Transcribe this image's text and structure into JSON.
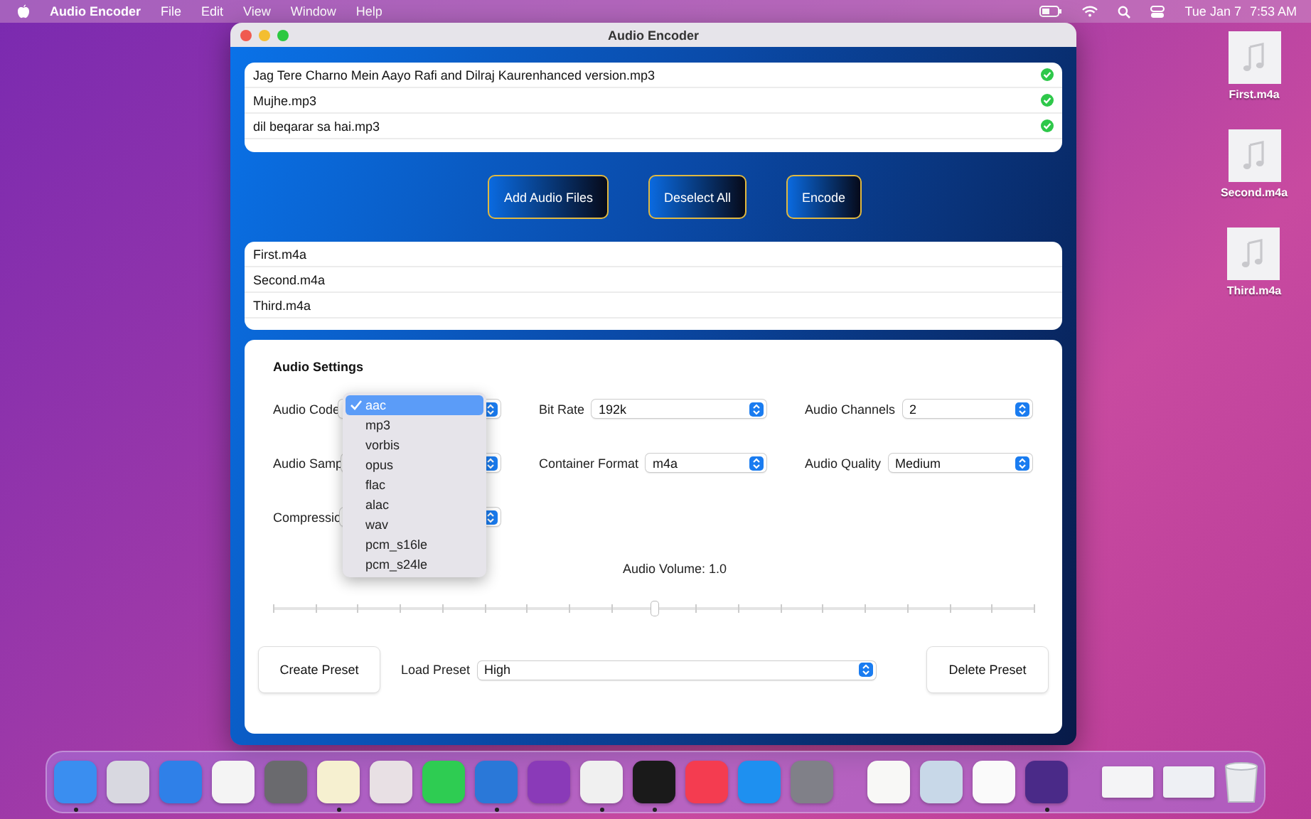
{
  "menu_bar": {
    "app_name": "Audio Encoder",
    "menus": [
      "File",
      "Edit",
      "View",
      "Window",
      "Help"
    ],
    "date": "Tue Jan 7",
    "time": "7:53 AM"
  },
  "window": {
    "title": "Audio Encoder"
  },
  "input_files": [
    {
      "name": "Jag Tere Charno Mein Aayo Rafi and Dilraj Kaurenhanced version.mp3",
      "done": true
    },
    {
      "name": "Mujhe.mp3",
      "done": true
    },
    {
      "name": "dil beqarar sa hai.mp3",
      "done": true
    }
  ],
  "buttons": [
    "Add Audio Files",
    "Deselect All",
    "Encode"
  ],
  "output_files": [
    "First.m4a",
    "Second.m4a",
    "Third.m4a"
  ],
  "settings": {
    "title": "Audio Settings",
    "fields": [
      {
        "label": "Audio Code"
      },
      {
        "label": "Bit Rate",
        "value": "192k"
      },
      {
        "label": "Audio Channels",
        "value": "2"
      },
      {
        "label": "Audio Samp"
      },
      {
        "label": "Container Format",
        "value": "m4a"
      },
      {
        "label": "Audio Quality",
        "value": "Medium"
      },
      {
        "label": "Compressio"
      }
    ]
  },
  "codec_menu": {
    "options": [
      {
        "label": "aac",
        "selected": true
      },
      {
        "label": "mp3",
        "selected": false
      },
      {
        "label": "vorbis",
        "selected": false
      },
      {
        "label": "opus",
        "selected": false
      },
      {
        "label": "flac",
        "selected": false
      },
      {
        "label": "alac",
        "selected": false
      },
      {
        "label": "wav",
        "selected": false
      },
      {
        "label": "pcm_s16le",
        "selected": false
      },
      {
        "label": "pcm_s24le",
        "selected": false
      }
    ]
  },
  "volume": {
    "label": "Audio Volume: 1.0",
    "level": 0.5
  },
  "presets": {
    "create": "Create Preset",
    "load_label": "Load Preset",
    "load_value": "High",
    "delete": "Delete Preset"
  },
  "desktop_files": [
    "First.m4a",
    "Second.m4a",
    "Third.m4a"
  ],
  "dock": [
    {
      "color": "#3a8ef0",
      "running": true
    },
    {
      "color": "#d8d8e0",
      "running": false
    },
    {
      "color": "#2f80e8",
      "running": false
    },
    {
      "color": "#f4f4f4",
      "running": false
    },
    {
      "color": "#6a6a6e",
      "running": false
    },
    {
      "color": "#f6f0d0",
      "running": true
    },
    {
      "color": "#e8e0e4",
      "running": false
    },
    {
      "color": "#2ecc52",
      "running": false
    },
    {
      "color": "#2a78d8",
      "running": true
    },
    {
      "color": "#8a3ab8",
      "running": false
    },
    {
      "color": "#f0f0f0",
      "running": true
    },
    {
      "color": "#1a1a1a",
      "running": true
    },
    {
      "color": "#f43c50",
      "running": false
    },
    {
      "color": "#1e90f0",
      "running": false
    },
    {
      "color": "#808088",
      "running": false
    },
    {
      "color": "#f8f8f6",
      "running": false
    },
    {
      "color": "#c8d8e8",
      "running": false
    },
    {
      "color": "#fafafa",
      "running": false
    },
    {
      "color": "#4a2a88",
      "running": true
    }
  ]
}
